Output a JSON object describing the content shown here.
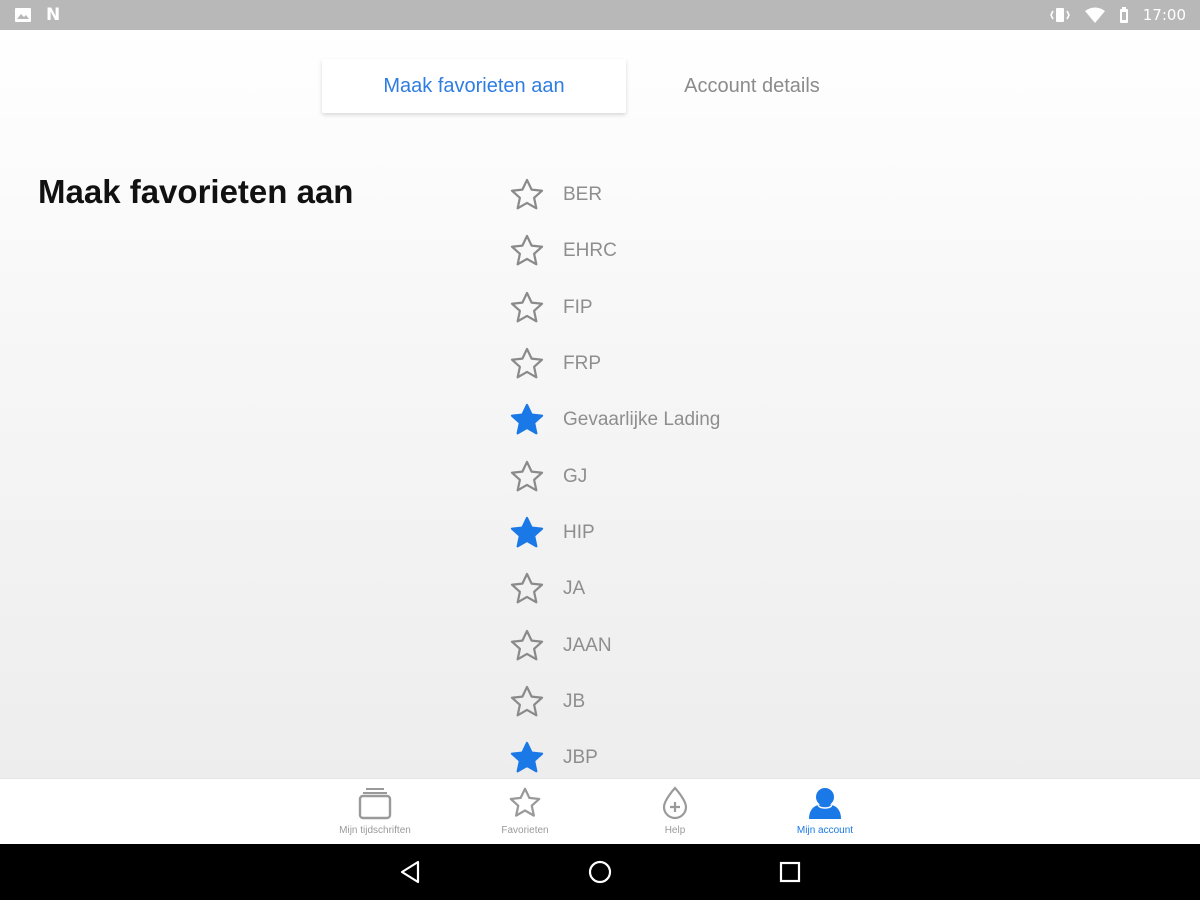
{
  "status_bar": {
    "time": "17:00",
    "left_icons": [
      "image-icon",
      "n-icon"
    ],
    "right_icons": [
      "vibrate-icon",
      "wifi-icon",
      "battery-icon"
    ]
  },
  "tabs": [
    {
      "label": "Maak favorieten aan",
      "active": true
    },
    {
      "label": "Account details",
      "active": false
    }
  ],
  "page_title": "Maak favorieten aan",
  "favorites": [
    {
      "label": "BER",
      "starred": false
    },
    {
      "label": "EHRC",
      "starred": false
    },
    {
      "label": "FIP",
      "starred": false
    },
    {
      "label": "FRP",
      "starred": false
    },
    {
      "label": "Gevaarlijke Lading",
      "starred": true
    },
    {
      "label": "GJ",
      "starred": false
    },
    {
      "label": "HIP",
      "starred": true
    },
    {
      "label": "JA",
      "starred": false
    },
    {
      "label": "JAAN",
      "starred": false
    },
    {
      "label": "JB",
      "starred": false
    },
    {
      "label": "JBP",
      "starred": true
    }
  ],
  "bottom_nav": [
    {
      "label": "Mijn tijdschriften",
      "icon": "magazines-icon",
      "active": false
    },
    {
      "label": "Favorieten",
      "icon": "star-icon",
      "active": false
    },
    {
      "label": "Help",
      "icon": "help-drop-icon",
      "active": false
    },
    {
      "label": "Mijn account",
      "icon": "account-icon",
      "active": true
    }
  ],
  "colors": {
    "accent": "#1a79e6",
    "inactive_text": "#8e8e8e",
    "star_outline": "#8a8a8a"
  }
}
